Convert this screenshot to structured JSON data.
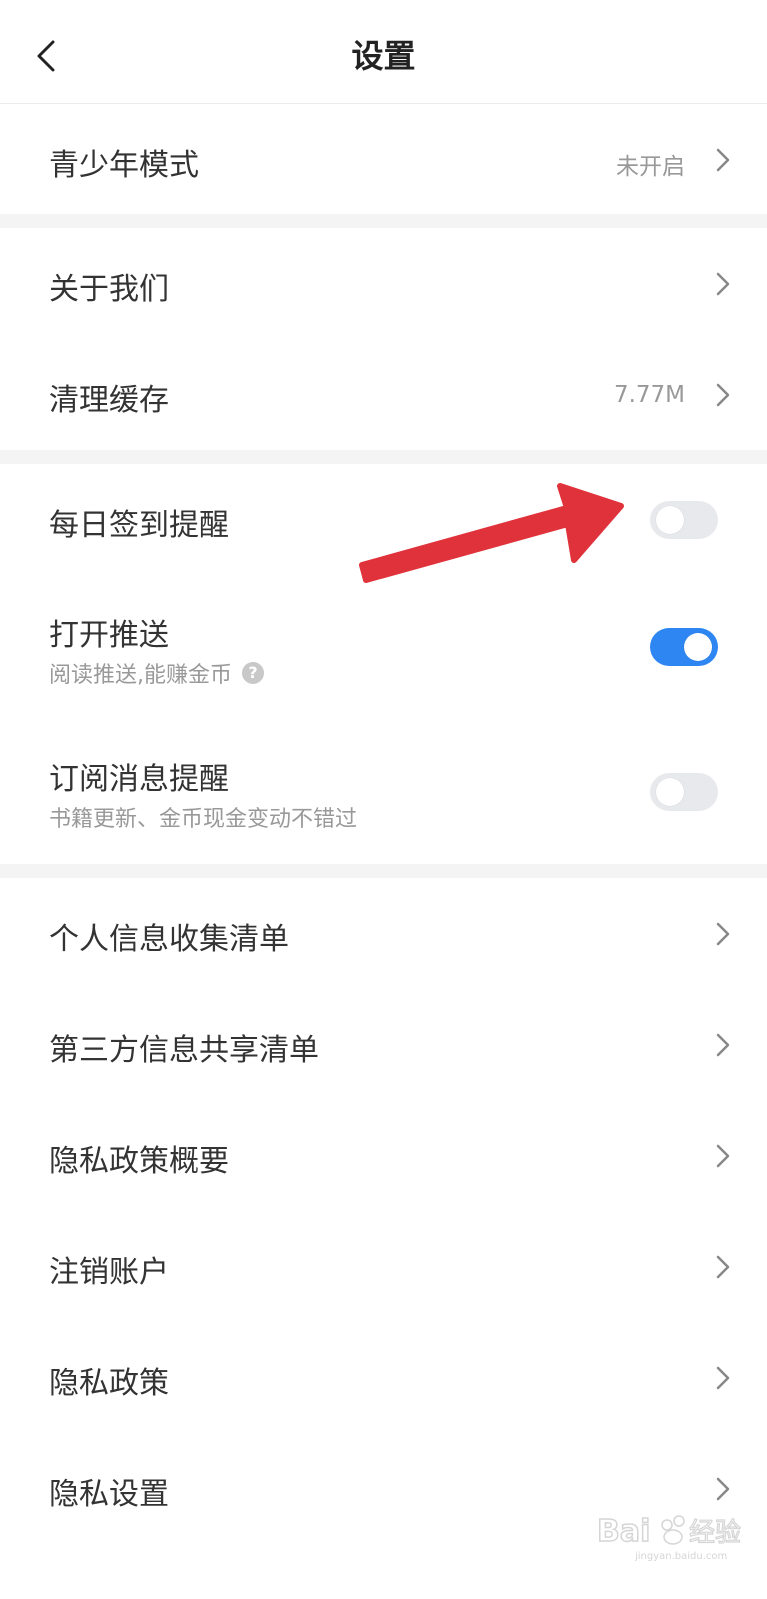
{
  "header": {
    "title": "设置",
    "back_icon": "chevron-left-icon"
  },
  "youth_mode": {
    "label": "青少年模式",
    "value": "未开启"
  },
  "about": {
    "label": "关于我们"
  },
  "clear_cache": {
    "label": "清理缓存",
    "value": "7.77M"
  },
  "daily_checkin": {
    "label": "每日签到提醒",
    "enabled": false
  },
  "push": {
    "label": "打开推送",
    "sub": "阅读推送,能赚金币",
    "help_icon": "question-circle-icon",
    "enabled": true
  },
  "subscription": {
    "label": "订阅消息提醒",
    "sub": "书籍更新、金币现金变动不错过",
    "enabled": false
  },
  "list": {
    "personal_info": "个人信息收集清单",
    "third_party": "第三方信息共享清单",
    "privacy_summary": "隐私政策概要",
    "cancel_account": "注销账户",
    "privacy_policy": "隐私政策",
    "privacy_settings": "隐私设置"
  },
  "colors": {
    "toggle_on": "#2e86f2",
    "toggle_off": "#e8e9ec",
    "arrow": "#e0323a",
    "background_gap": "#f4f4f4"
  },
  "watermark": {
    "text": "Bai经验",
    "sub": "jingyan.baidu.com"
  }
}
